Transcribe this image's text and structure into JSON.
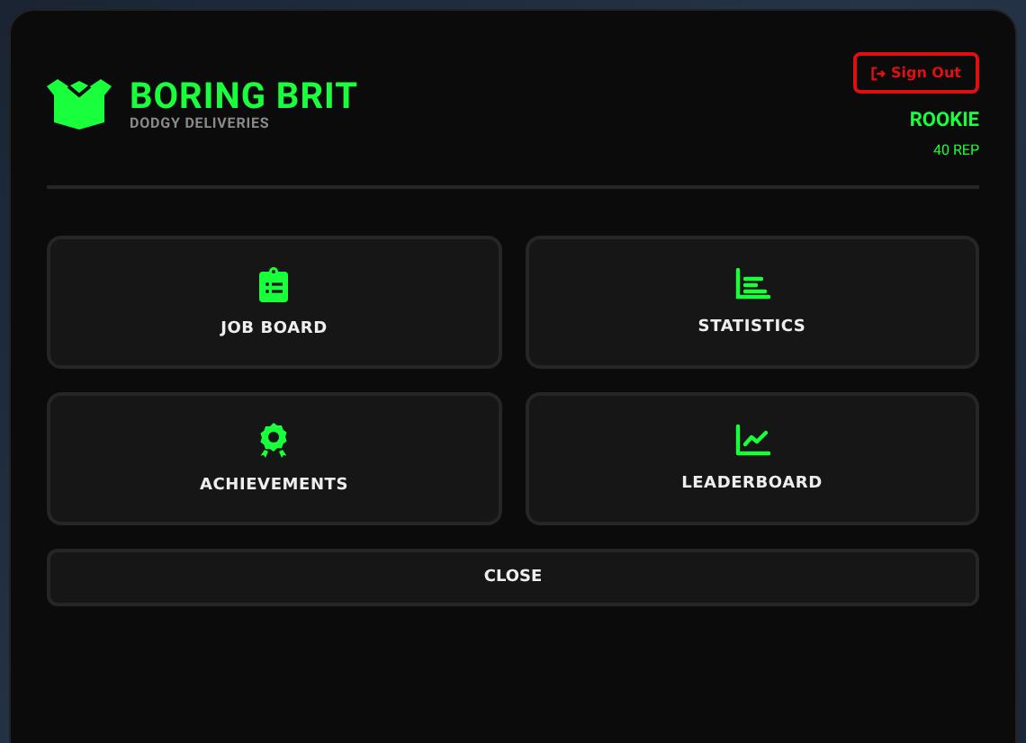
{
  "header": {
    "title": "BORING BRIT",
    "subtitle": "DODGY DELIVERIES",
    "sign_out": "Sign Out",
    "rank": "ROOKIE",
    "rep": "40 REP"
  },
  "menu": [
    {
      "label": "JOB BOARD"
    },
    {
      "label": "STATISTICS"
    },
    {
      "label": "ACHIEVEMENTS"
    },
    {
      "label": "LEADERBOARD"
    }
  ],
  "close_button": "CLOSE"
}
